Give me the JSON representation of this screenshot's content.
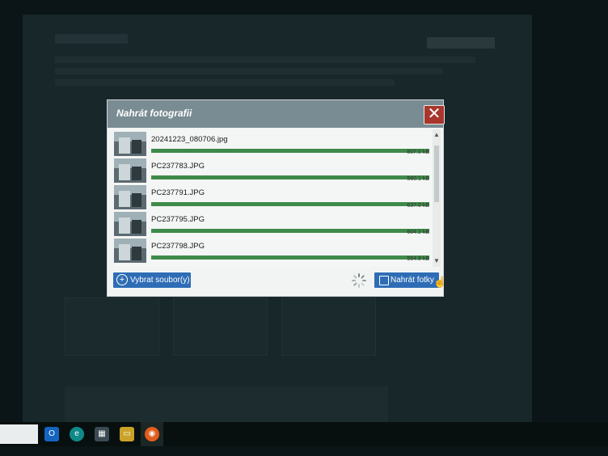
{
  "background": {
    "note_colors": {
      "page": "#18272a"
    }
  },
  "modal": {
    "title": "Nahrát fotografii",
    "close_symbol": "✕",
    "files": [
      {
        "name": "20241223_080706.jpg",
        "size": "807.0 kB",
        "progress": 1.0
      },
      {
        "name": "PC237783.JPG",
        "size": "560.1 kB",
        "progress": 1.0
      },
      {
        "name": "PC237791.JPG",
        "size": "637.0 kB",
        "progress": 1.0
      },
      {
        "name": "PC237795.JPG",
        "size": "604.2 kB",
        "progress": 1.0
      },
      {
        "name": "PC237798.JPG",
        "size": "554.8 kB",
        "progress": 1.0
      }
    ],
    "select_button": "Vybrat soubor(y)",
    "upload_button": "Nahrát fotky",
    "accent_color": "#2e6db5",
    "progress_color": "#3f8a4a"
  },
  "taskbar": {
    "icons": [
      "outlook-icon",
      "edge-icon",
      "store-icon",
      "file-explorer-icon",
      "firefox-icon"
    ]
  }
}
